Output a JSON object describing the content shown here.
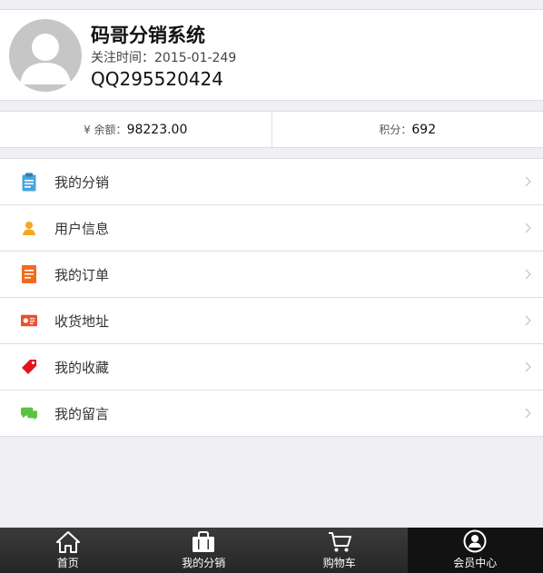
{
  "profile": {
    "name": "码哥分销系统",
    "follow_time": "关注时间：2015-01-249",
    "qq": "QQ295520424"
  },
  "stats": {
    "balance_label": "¥ 余额：",
    "balance_value": "98223.00",
    "points_label": "积分：",
    "points_value": "692"
  },
  "menu": {
    "items": [
      {
        "label": "我的分销",
        "icon": "clipboard-icon",
        "color": "#4aa3df"
      },
      {
        "label": "用户信息",
        "icon": "user-icon",
        "color": "#f5a623"
      },
      {
        "label": "我的订单",
        "icon": "order-icon",
        "color": "#f26b1d"
      },
      {
        "label": "收货地址",
        "icon": "address-card-icon",
        "color": "#e8512e"
      },
      {
        "label": "我的收藏",
        "icon": "tag-icon",
        "color": "#e0161e"
      },
      {
        "label": "我的留言",
        "icon": "chat-icon",
        "color": "#5cc341"
      }
    ]
  },
  "tabbar": {
    "tabs": [
      {
        "label": "首页",
        "icon": "home-icon"
      },
      {
        "label": "我的分销",
        "icon": "shopping-bag-icon"
      },
      {
        "label": "购物车",
        "icon": "cart-icon"
      },
      {
        "label": "会员中心",
        "icon": "member-icon"
      }
    ],
    "active": "会员中心"
  }
}
